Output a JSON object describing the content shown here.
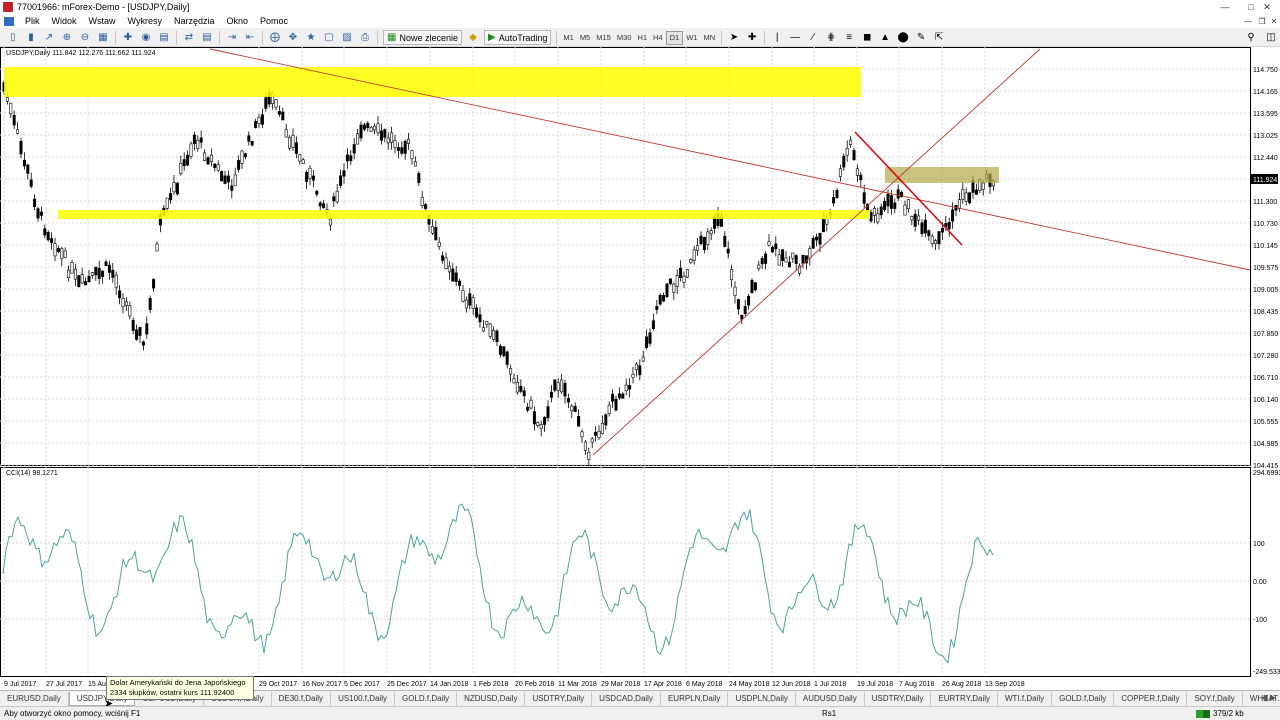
{
  "window": {
    "title": "77001966: mForex-Demo - [USDJPY,Daily]"
  },
  "menu": [
    "Plik",
    "Widok",
    "Wstaw",
    "Wykresy",
    "Narzędzia",
    "Okno",
    "Pomoc"
  ],
  "toolbar": {
    "new_order_label": "Nowe zlecenie",
    "autotrading_label": "AutoTrading",
    "timeframes": [
      "M1",
      "M5",
      "M15",
      "M30",
      "H1",
      "H4",
      "D1",
      "W1",
      "MN"
    ],
    "active_timeframe": "D1"
  },
  "chart": {
    "info": "USDJPY,Daily  111.842 112.276 111.662 111.924",
    "current_price": "111.924",
    "price_axis": [
      "114.750",
      "114.165",
      "113.595",
      "113.025",
      "112.440",
      "111.924",
      "111.300",
      "110.730",
      "110.145",
      "109.575",
      "109.005",
      "108.435",
      "107.850",
      "107.280",
      "106.710",
      "106.140",
      "105.555",
      "104.985",
      "104.415"
    ],
    "date_axis": [
      "9 Jul 2017",
      "27 Jul 2017",
      "15 Au",
      "29 Oct 2017",
      "16 Nov 2017",
      "5 Dec 2017",
      "25 Dec 2017",
      "14 Jan 2018",
      "1 Feb 2018",
      "20 Feb 2018",
      "11 Mar 2018",
      "29 Mar 2018",
      "17 Apr 2018",
      "6 May 2018",
      "24 May 2018",
      "12 Jun 2018",
      "1 Jul 2018",
      "19 Jul 2018",
      "7 Aug 2018",
      "26 Aug 2018",
      "13 Sep 2018"
    ],
    "colors": {
      "highlight": "#ffff00",
      "zone": "#b5a84a",
      "trendline": "#c0392b",
      "candle": "#000000",
      "cci": "#4aa3a0"
    }
  },
  "indicator": {
    "info": "CCI(14) 98.1271",
    "axis": [
      "294.6993",
      "100",
      "0.00",
      "-100",
      "-249.5337"
    ]
  },
  "tabs": [
    "EURUSD,Daily",
    "USDJPY,Daily",
    "GBPUSD,Daily",
    "USDCHF,Daily",
    "DE30.f,Daily",
    "US100.f,Daily",
    "GOLD.f,Daily",
    "NZDUSD,Daily",
    "USDTRY,Daily",
    "USDCAD,Daily",
    "EURPLN,Daily",
    "USDPLN,Daily",
    "AUDUSD,Daily",
    "USDTRY,Daily",
    "EURTRY,Daily",
    "WTI.f,Daily",
    "GOLD.f,Daily",
    "COPPER.f,Daily",
    "SOY.f,Daily",
    "WHEAT.US.f,Daily"
  ],
  "active_tab": "USDJPY,Daily",
  "tooltip": {
    "line1": "Dolar Amerykański do Jena Japońskiego",
    "line2": "2334 słupków, ostatni kurs 111.92400"
  },
  "status": {
    "help": "Aby otworzyć okno pomocy, wciśnij F1",
    "profile": "Rs1",
    "connection": "379/2 kb"
  }
}
